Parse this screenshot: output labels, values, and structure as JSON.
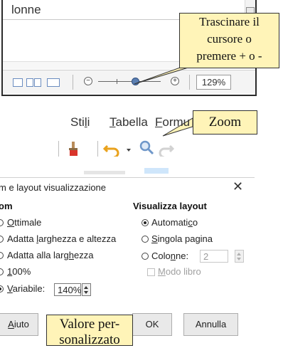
{
  "top_window": {
    "content_text": "lonne",
    "zoom_minus": "−",
    "zoom_plus": "+",
    "zoom_value": "129%"
  },
  "callouts": {
    "drag_lines": [
      "Trascinare il",
      "cursore o",
      "premere + o -"
    ],
    "zoom": "Zoom",
    "custom_lines": [
      "Valore per-",
      "sonalizzato"
    ]
  },
  "menu": {
    "items": [
      {
        "label": "Stili",
        "mnemonic_index": 2
      },
      {
        "label": "Tabella",
        "mnemonic_index": 0
      },
      {
        "label": "Formu",
        "mnemonic_index": 0
      }
    ]
  },
  "toolbar": {
    "icons": [
      "clone-formatting-icon",
      "undo-icon",
      "dropdown-arrow-icon",
      "zoom-icon",
      "redo-icon"
    ],
    "colors": {
      "brush": "#d9342b",
      "undo": "#e9a21d",
      "zoom": "#6f97c9"
    }
  },
  "dialog": {
    "title": "m e layout visualizzazione",
    "close_glyph": "✕",
    "zoom_section": {
      "title": "om",
      "options": [
        {
          "label": "Ottimale",
          "selected": false
        },
        {
          "label": "Adatta larghezza e altezza",
          "selected": false
        },
        {
          "label": "Adatta alla larghezza",
          "selected": false
        },
        {
          "label": "100%",
          "selected": false
        },
        {
          "label": "Variabile:",
          "selected": true
        }
      ],
      "variable_value": "140%"
    },
    "layout_section": {
      "title": "Visualizza layout",
      "options": [
        {
          "label": "Automatico",
          "selected": true
        },
        {
          "label": "Singola pagina",
          "selected": false
        },
        {
          "label": "Colonne:",
          "selected": false
        }
      ],
      "columns_value": "2",
      "book_mode_label": "Modo libro"
    },
    "buttons": {
      "help": "Aiuto",
      "ok": "OK",
      "cancel": "Annulla"
    }
  }
}
